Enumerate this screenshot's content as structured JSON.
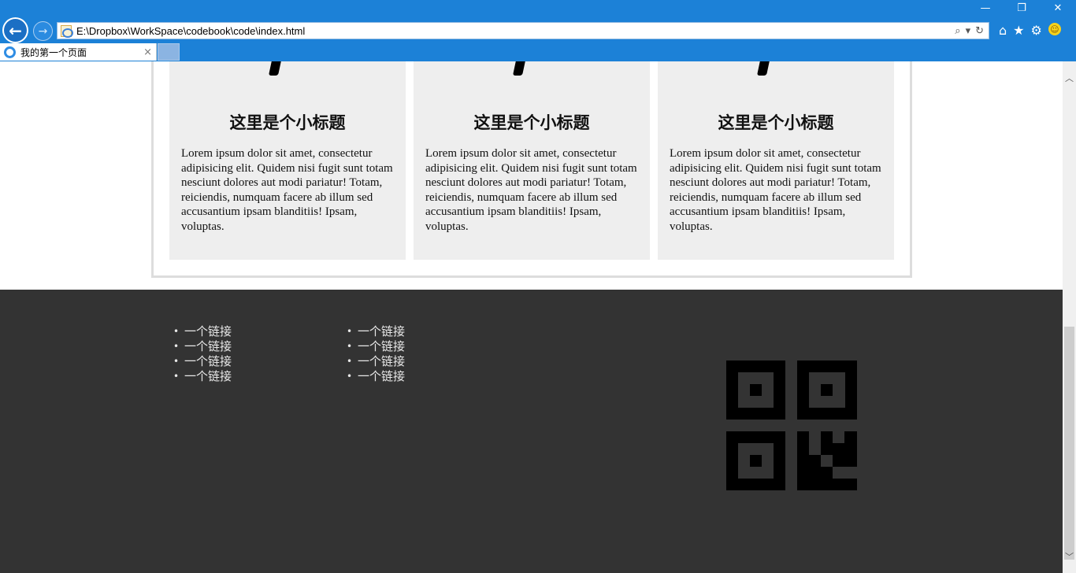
{
  "browser": {
    "url": "E:\\Dropbox\\WorkSpace\\codebook\\code\\index.html",
    "tab_title": "我的第一个页面",
    "tab_close": "×",
    "back_glyph": "←",
    "forward_glyph": "→",
    "window_controls": {
      "minimize": "—",
      "restore": "❐",
      "close": "✕"
    },
    "addr_tools": {
      "search": "⌕",
      "dropdown": "▾",
      "refresh": "↻"
    },
    "toolbar": {
      "home": "⌂",
      "favorites": "★",
      "settings": "⚙",
      "feedback": "☺"
    }
  },
  "cards": [
    {
      "title": "这里是个小标题",
      "body": "Lorem ipsum dolor sit amet, consectetur adipisicing elit. Quidem nisi fugit sunt totam nesciunt dolores aut modi pariatur! Totam, reiciendis, numquam facere ab illum sed accusantium ipsam blanditiis! Ipsam, voluptas."
    },
    {
      "title": "这里是个小标题",
      "body": "Lorem ipsum dolor sit amet, consectetur adipisicing elit. Quidem nisi fugit sunt totam nesciunt dolores aut modi pariatur! Totam, reiciendis, numquam facere ab illum sed accusantium ipsam blanditiis! Ipsam, voluptas."
    },
    {
      "title": "这里是个小标题",
      "body": "Lorem ipsum dolor sit amet, consectetur adipisicing elit. Quidem nisi fugit sunt totam nesciunt dolores aut modi pariatur! Totam, reiciendis, numquam facere ab illum sed accusantium ipsam blanditiis! Ipsam, voluptas."
    }
  ],
  "footer": {
    "links_col1": [
      "一个链接",
      "一个链接",
      "一个链接",
      "一个链接"
    ],
    "links_col2": [
      "一个链接",
      "一个链接",
      "一个链接",
      "一个链接"
    ]
  },
  "colors": {
    "chrome": "#1c81d7",
    "card_bg": "#eeeeee",
    "footer_bg": "#333333",
    "qr": "#000000"
  }
}
